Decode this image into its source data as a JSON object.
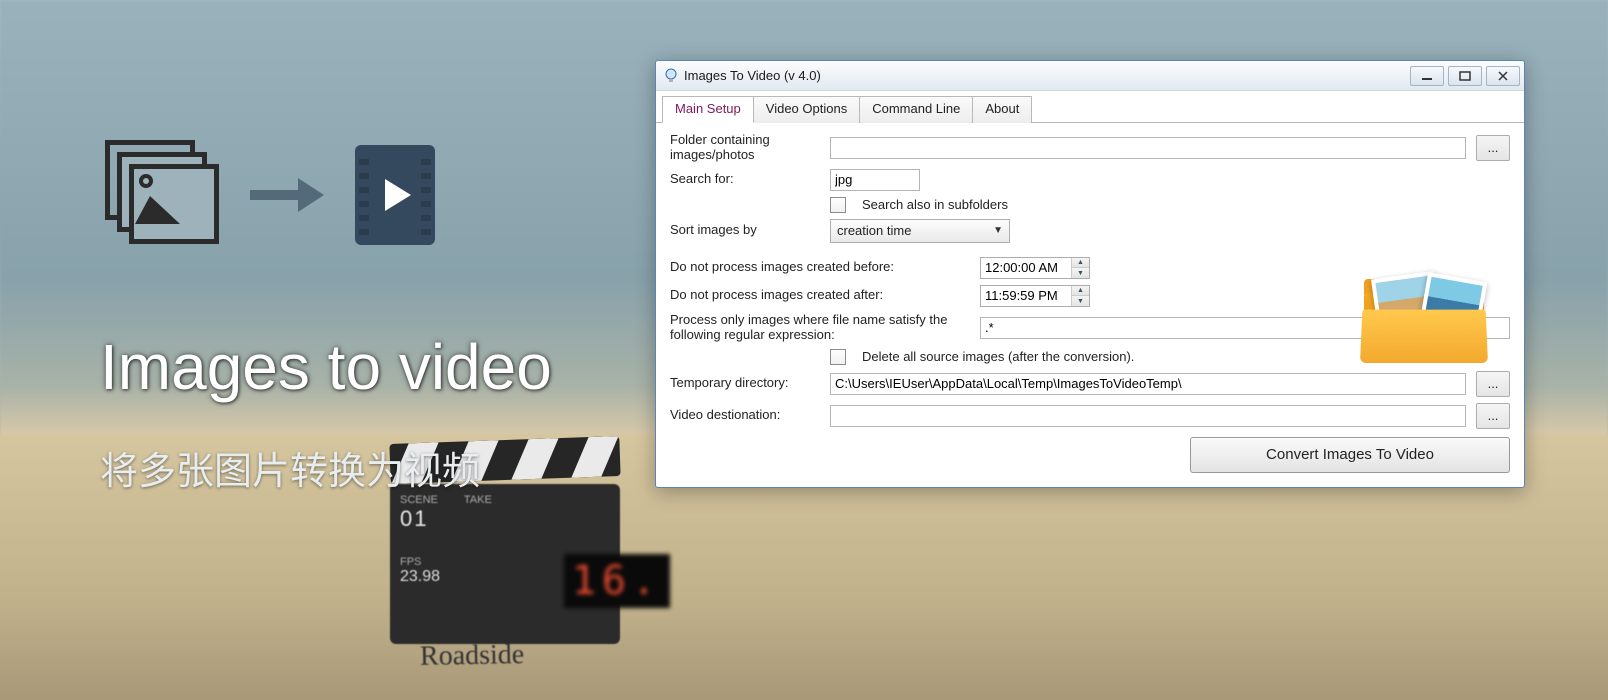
{
  "hero": {
    "title": "Images to video",
    "subtitle": "将多张图片转换为视频"
  },
  "clapper": {
    "scene_label": "SCENE",
    "take_label": "TAKE",
    "fps_label": "FPS",
    "scene": "01",
    "fps": "23.98",
    "digits": "16.",
    "script": "Roadside"
  },
  "window": {
    "title": "Images To Video (v 4.0)",
    "tabs": [
      "Main Setup",
      "Video Options",
      "Command Line",
      "About"
    ],
    "active_tab": 0,
    "labels": {
      "folder": "Folder containing images/photos",
      "search_for": "Search for:",
      "subfolders": "Search also in subfolders",
      "sort_by": "Sort images by",
      "not_before": "Do not process images created before:",
      "not_after": "Do not process images created after:",
      "regex": "Process only images where file name satisfy the following regular expression:",
      "delete_src": "Delete all source images (after the conversion).",
      "tempdir": "Temporary directory:",
      "dest": "Video destionation:"
    },
    "values": {
      "folder": "",
      "search_for": "jpg",
      "subfolders_checked": false,
      "sort_by": "creation time",
      "not_before": "12:00:00 AM",
      "not_after": "11:59:59 PM",
      "regex": ".*",
      "delete_src_checked": false,
      "tempdir": "C:\\Users\\IEUser\\AppData\\Local\\Temp\\ImagesToVideoTemp\\",
      "dest": ""
    },
    "browse_label": "...",
    "convert_button": "Convert Images To Video"
  }
}
